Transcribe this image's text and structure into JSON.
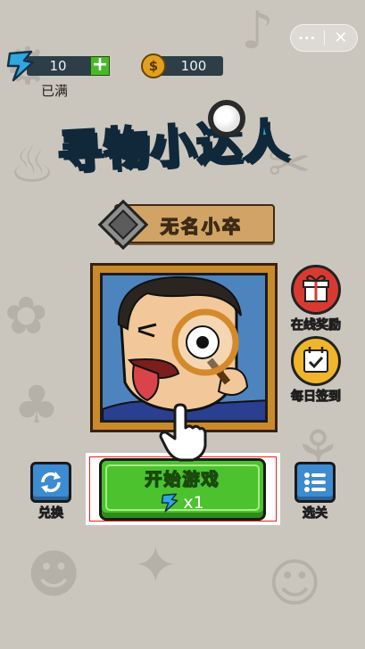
{
  "top_bar": {
    "energy": {
      "value": "10",
      "status": "已满",
      "icon": "energy-bolt-icon"
    },
    "coins": {
      "value": "100",
      "icon": "dollar-coin-icon"
    },
    "capsule": {
      "more": "···",
      "close": "✕"
    }
  },
  "title": {
    "text": "寻物小达人"
  },
  "player": {
    "name": "无名小卒",
    "rank_icon": "diamond-rank-icon"
  },
  "side_buttons": {
    "online_reward": "在线奖励",
    "daily_signin": "每日签到",
    "exchange": "兑换",
    "levels": "选关"
  },
  "start": {
    "label": "开始游戏",
    "cost": "x1"
  },
  "colors": {
    "background": "#cbc6bd",
    "title_blue": "#26a7d6",
    "start_green": "#4bc22e",
    "frame_brown": "#c98a2b",
    "highlight_red": "#e8231f"
  }
}
